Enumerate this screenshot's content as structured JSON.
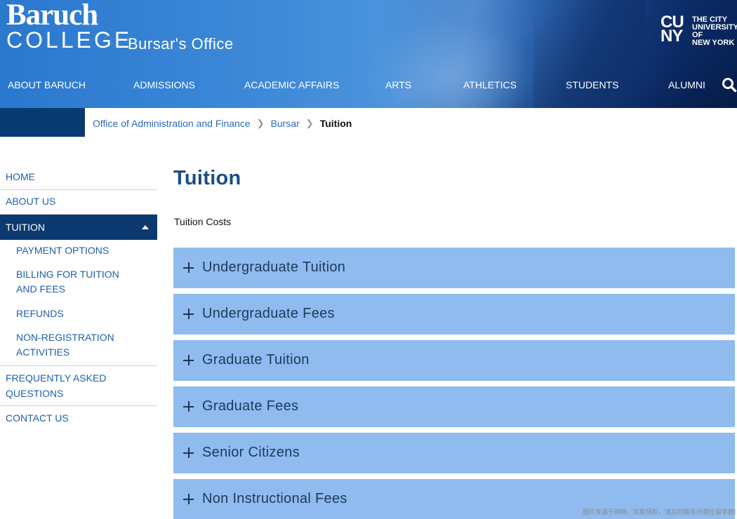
{
  "header": {
    "logo_line1": "Baruch",
    "logo_line2": "COLLEGE",
    "site_title": "Bursar's Office",
    "cuny_letters_1": "CU",
    "cuny_letters_2": "NY",
    "cuny_text": [
      "THE CITY",
      "UNIVERSITY",
      "OF",
      "NEW YORK"
    ],
    "nav": [
      "ABOUT BARUCH",
      "ADMISSIONS",
      "ACADEMIC AFFAIRS",
      "ARTS",
      "ATHLETICS",
      "STUDENTS",
      "ALUMNI"
    ],
    "search_icon": "search-icon"
  },
  "breadcrumb": {
    "items": [
      "Office of Administration and Finance",
      "Bursar"
    ],
    "separator": "❯",
    "current": "Tuition"
  },
  "sidebar": {
    "items": [
      {
        "label": "HOME"
      },
      {
        "label": "ABOUT US"
      },
      {
        "label": "TUITION"
      },
      {
        "label": "PAYMENT OPTIONS"
      },
      {
        "label_lines": [
          "BILLING FOR TUITION",
          "AND FEES"
        ]
      },
      {
        "label": "REFUNDS"
      },
      {
        "label_lines": [
          "NON-REGISTRATION",
          "ACTIVITIES"
        ]
      },
      {
        "label_lines": [
          "FREQUENTLY ASKED",
          "QUESTIONS"
        ]
      },
      {
        "label": "CONTACT US"
      }
    ]
  },
  "main": {
    "title": "Tuition",
    "intro": "Tuition Costs",
    "accordions": [
      "Undergraduate Tuition",
      "Undergraduate Fees",
      "Graduate Tuition",
      "Graduate Fees",
      "Senior Citizens",
      "Non Instructional Fees"
    ]
  },
  "watermark": "图片来源于网络，如有侵权，请及时联系托普仕留学删除",
  "colors": {
    "nav_active": "#0c3a70",
    "link": "#1f5fa8",
    "accordion_bg": "#8fbbef",
    "title": "#1d4d86"
  }
}
